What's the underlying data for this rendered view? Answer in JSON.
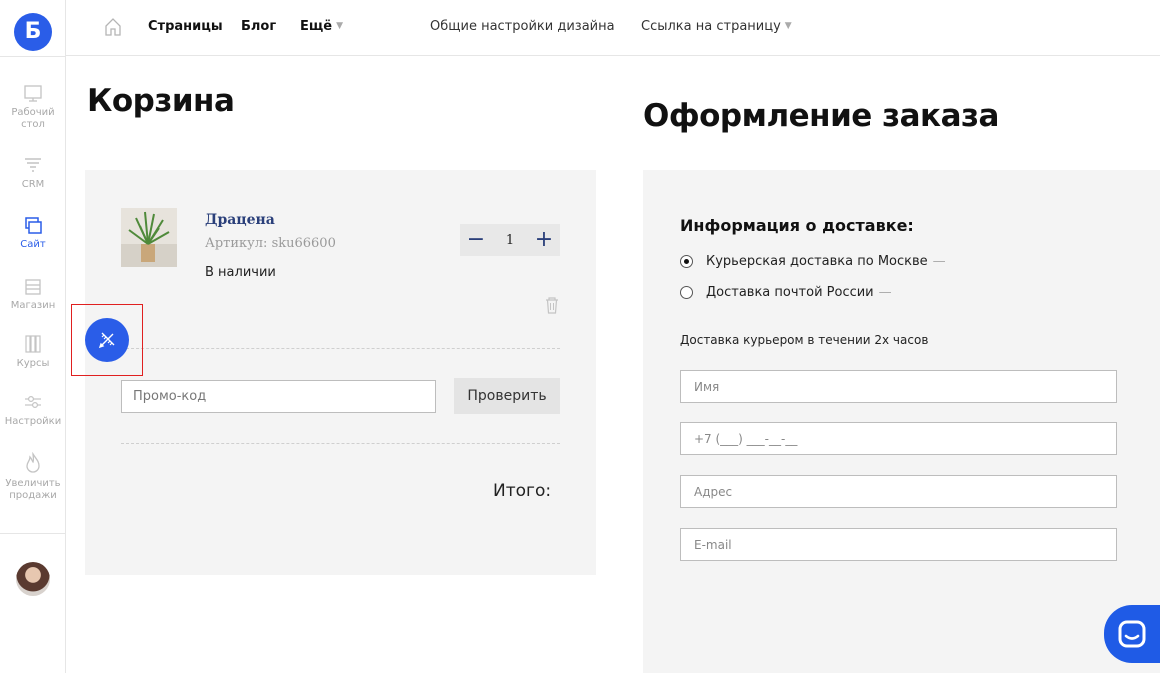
{
  "brand": {
    "logo_letter": "Б",
    "accent": "#2a5de8"
  },
  "sidebar": {
    "items": [
      {
        "label": "Рабочий стол",
        "icon": "monitor-icon"
      },
      {
        "label": "CRM",
        "icon": "funnel-icon"
      },
      {
        "label": "Сайт",
        "icon": "site-icon",
        "active": true
      },
      {
        "label": "Магазин",
        "icon": "store-icon"
      },
      {
        "label": "Курсы",
        "icon": "books-icon"
      },
      {
        "label": "Настройки",
        "icon": "sliders-icon"
      },
      {
        "label": "Увеличить продажи",
        "icon": "flame-icon"
      }
    ]
  },
  "topbar": {
    "nav": [
      "Страницы",
      "Блог",
      "Ещё"
    ],
    "design_settings": "Общие настройки дизайна",
    "page_link": "Ссылка на страницу"
  },
  "cart": {
    "title": "Корзина",
    "product": {
      "name": "Драцена",
      "sku": "Артикул: sku66600",
      "stock": "В наличии",
      "quantity": "1"
    },
    "promo_placeholder": "Промо-код",
    "promo_button": "Проверить",
    "total_label": "Итого:"
  },
  "order": {
    "title": "Оформление заказа",
    "delivery_title": "Информация о доставке:",
    "options": [
      {
        "label": "Курьерская доставка по Москве",
        "checked": true
      },
      {
        "label": "Доставка почтой России",
        "checked": false
      }
    ],
    "note": "Доставка курьером в течении 2х часов",
    "fields": {
      "name": "Имя",
      "phone": "+7 (___) ___-__-__",
      "address": "Адрес",
      "email": "E-mail"
    }
  }
}
